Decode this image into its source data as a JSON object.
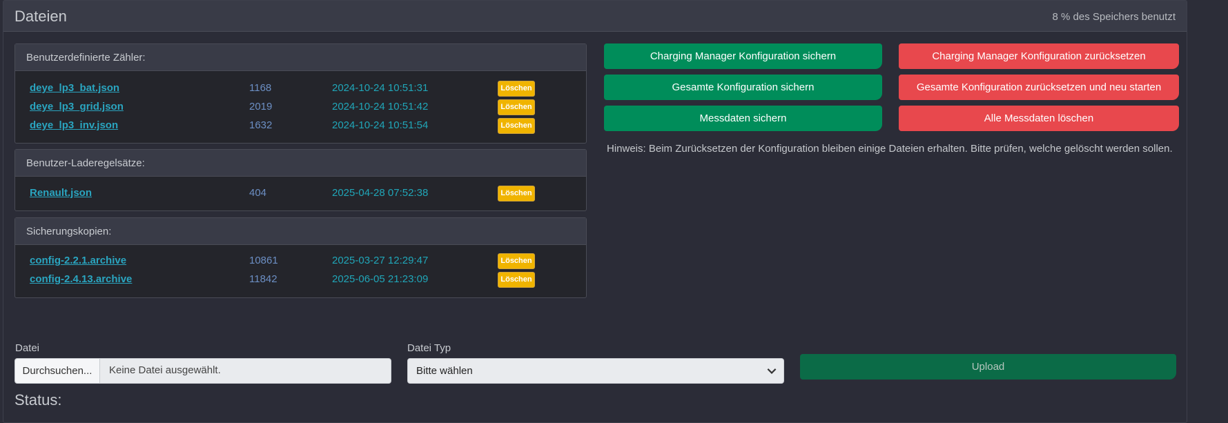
{
  "header": {
    "title": "Dateien",
    "usage": "8 % des Speichers benutzt"
  },
  "sections": [
    {
      "title": "Benutzerdefinierte Zähler:",
      "files": [
        {
          "name": "deye_lp3_bat.json",
          "size": "1168",
          "date": "2024-10-24 10:51:31",
          "delete": "Löschen"
        },
        {
          "name": "deye_lp3_grid.json",
          "size": "2019",
          "date": "2024-10-24 10:51:42",
          "delete": "Löschen"
        },
        {
          "name": "deye_lp3_inv.json",
          "size": "1632",
          "date": "2024-10-24 10:51:54",
          "delete": "Löschen"
        }
      ]
    },
    {
      "title": "Benutzer-Laderegelsätze:",
      "files": [
        {
          "name": "Renault.json",
          "size": "404",
          "date": "2025-04-28 07:52:38",
          "delete": "Löschen"
        }
      ]
    },
    {
      "title": "Sicherungskopien:",
      "files": [
        {
          "name": "config-2.2.1.archive",
          "size": "10861",
          "date": "2025-03-27 12:29:47",
          "delete": "Löschen"
        },
        {
          "name": "config-2.4.13.archive",
          "size": "11842",
          "date": "2025-06-05 21:23:09",
          "delete": "Löschen"
        }
      ]
    }
  ],
  "actions": {
    "backup_cm": "Charging Manager Konfiguration sichern",
    "reset_cm": "Charging Manager Konfiguration zurücksetzen",
    "backup_all": "Gesamte Konfiguration sichern",
    "reset_all": "Gesamte Konfiguration zurücksetzen und neu starten",
    "backup_measure": "Messdaten sichern",
    "delete_measure": "Alle Messdaten löschen",
    "hint": "Hinweis: Beim Zurücksetzen der Konfiguration bleiben einige Dateien erhalten. Bitte prüfen, welche gelöscht werden sollen."
  },
  "upload": {
    "file_label": "Datei",
    "browse": "Durchsuchen...",
    "no_file": "Keine Datei ausgewählt.",
    "type_label": "Datei Typ",
    "type_selected": "Bitte wählen",
    "button": "Upload"
  },
  "status_label": "Status:",
  "colors": {
    "green": "#008d5a",
    "red": "#e8484d",
    "delete_yellow": "#f0b400",
    "link": "#2aa5c0"
  }
}
